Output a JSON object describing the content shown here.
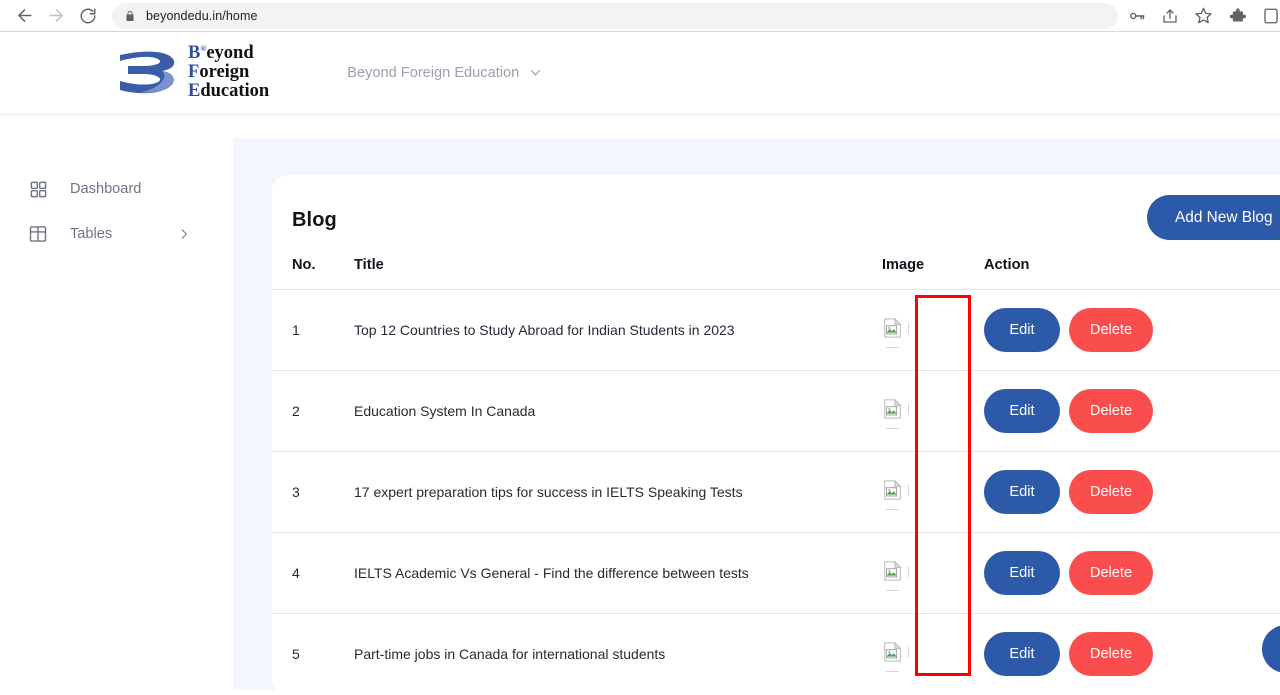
{
  "browser": {
    "url": "beyondedu.in/home",
    "back_icon": "back-arrow-icon",
    "forward_icon": "forward-arrow-icon",
    "reload_icon": "reload-icon",
    "lock_icon": "lock-icon",
    "toolbar_icons": [
      "password-key-icon",
      "share-icon",
      "bookmark-star-icon",
      "extensions-puzzle-icon",
      "profile-icon"
    ]
  },
  "header": {
    "brand": {
      "line1_cap": "B",
      "line1_rest": "eyond",
      "line2_cap": "F",
      "line2_rest": "oreign",
      "line3_cap": "E",
      "line3_rest": "ducation",
      "registered": "®"
    },
    "org_selector": {
      "label": "Beyond Foreign Education",
      "chevron": "chevron-down-icon"
    }
  },
  "sidebar": {
    "items": [
      {
        "label": "Dashboard",
        "icon": "grid-squares-icon",
        "has_chevron": false
      },
      {
        "label": "Tables",
        "icon": "table-icon",
        "has_chevron": true,
        "chevron": "chevron-right-icon"
      }
    ]
  },
  "main": {
    "card_title": "Blog",
    "add_button_label": "Add New Blog",
    "table": {
      "columns": [
        "No.",
        "Title",
        "Image",
        "Action"
      ],
      "rows": [
        {
          "no": "1",
          "title": "Top 12 Countries to Study Abroad for Indian Students in 2023",
          "image": "broken-image-icon",
          "edit_label": "Edit",
          "delete_label": "Delete"
        },
        {
          "no": "2",
          "title": "Education System In Canada",
          "image": "broken-image-icon",
          "edit_label": "Edit",
          "delete_label": "Delete"
        },
        {
          "no": "3",
          "title": "17 expert preparation tips for success in IELTS Speaking Tests",
          "image": "broken-image-icon",
          "edit_label": "Edit",
          "delete_label": "Delete"
        },
        {
          "no": "4",
          "title": "IELTS Academic Vs General - Find the difference between tests",
          "image": "broken-image-icon",
          "edit_label": "Edit",
          "delete_label": "Delete"
        },
        {
          "no": "5",
          "title": "Part-time jobs in Canada for international students",
          "image": "broken-image-icon",
          "edit_label": "Edit",
          "delete_label": "Delete"
        }
      ]
    }
  },
  "annotation": {
    "type": "highlight-rectangle",
    "color": "#ff0000",
    "targets": "image-column"
  },
  "colors": {
    "primary_blue": "#2d5aa8",
    "danger_red": "#fa4e4e",
    "content_bg": "#f4f6fd",
    "card_bg": "#ffffff",
    "text_muted": "#6d7585"
  }
}
